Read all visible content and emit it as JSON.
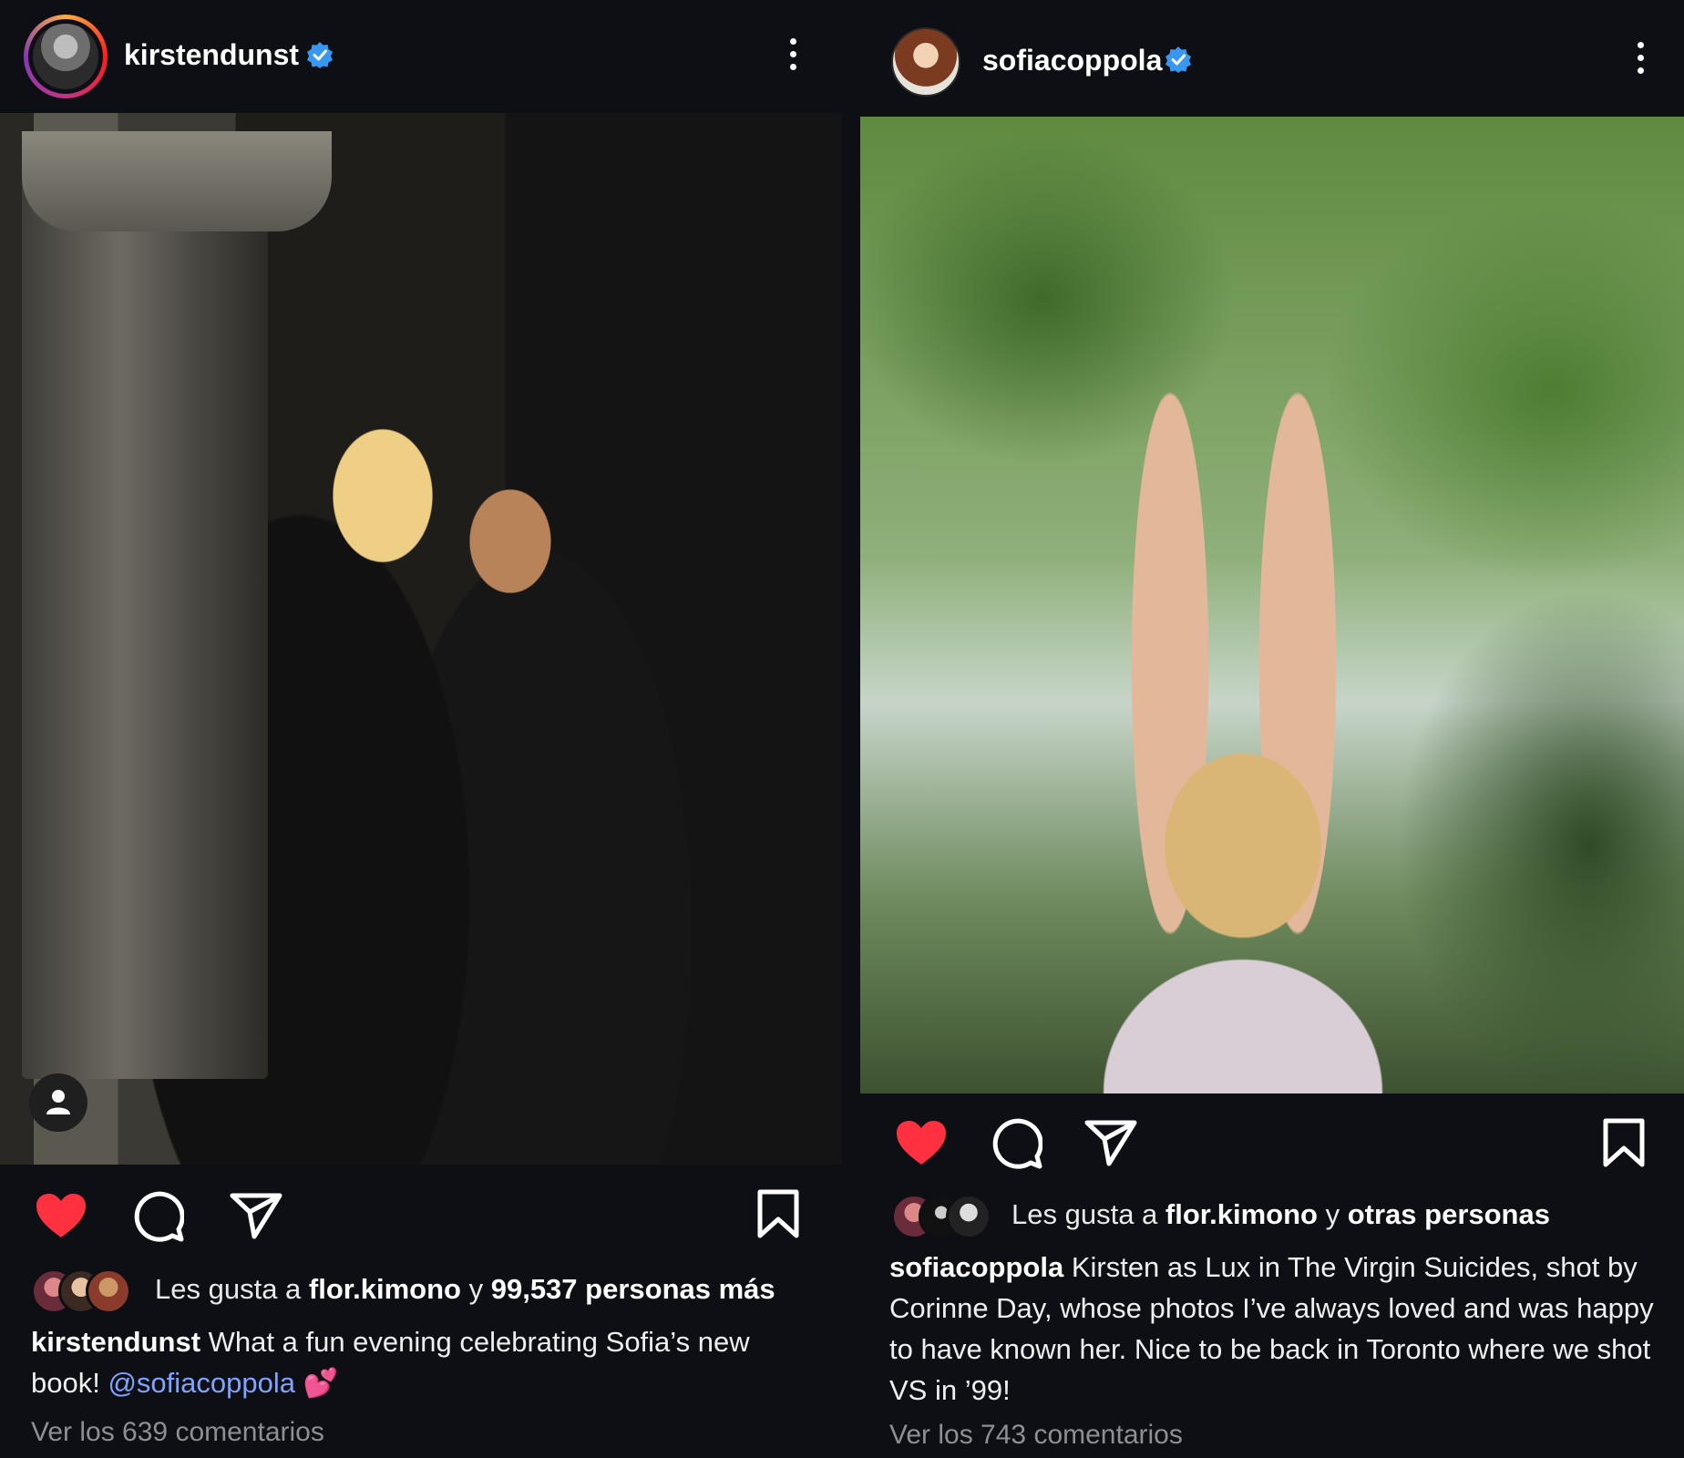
{
  "posts": [
    {
      "username": "kirstendunst",
      "likes_prefix": "Les gusta a ",
      "likes_user": "flor.kimono",
      "likes_joiner": " y ",
      "likes_rest": "99,537 personas más",
      "caption_user": "kirstendunst",
      "caption_text": " What a fun evening celebrating Sofia’s new book! ",
      "caption_mention": "@sofiacoppola",
      "caption_emoji": "💕",
      "comments": "Ver los 639 comentarios"
    },
    {
      "username": "sofiacoppola",
      "likes_prefix": "Les gusta a ",
      "likes_user": "flor.kimono",
      "likes_joiner": " y ",
      "likes_rest": "otras personas",
      "caption_user": "sofiacoppola",
      "caption_text": " Kirsten as Lux in The Virgin Suicides, shot by Corinne Day, whose photos I’ve always loved and was happy to have known her. Nice to be back in Toronto where we shot VS in ’99!",
      "comments": "Ver los 743 comentarios"
    }
  ],
  "colors": {
    "background": "#0d0f14",
    "like_red": "#ff3040",
    "verified_blue": "#3897f0",
    "mention_blue": "#7ea4ff"
  },
  "icons": [
    "verified-icon",
    "more-options-icon",
    "heart-icon",
    "comment-icon",
    "share-icon",
    "bookmark-icon",
    "tagged-user-icon"
  ]
}
